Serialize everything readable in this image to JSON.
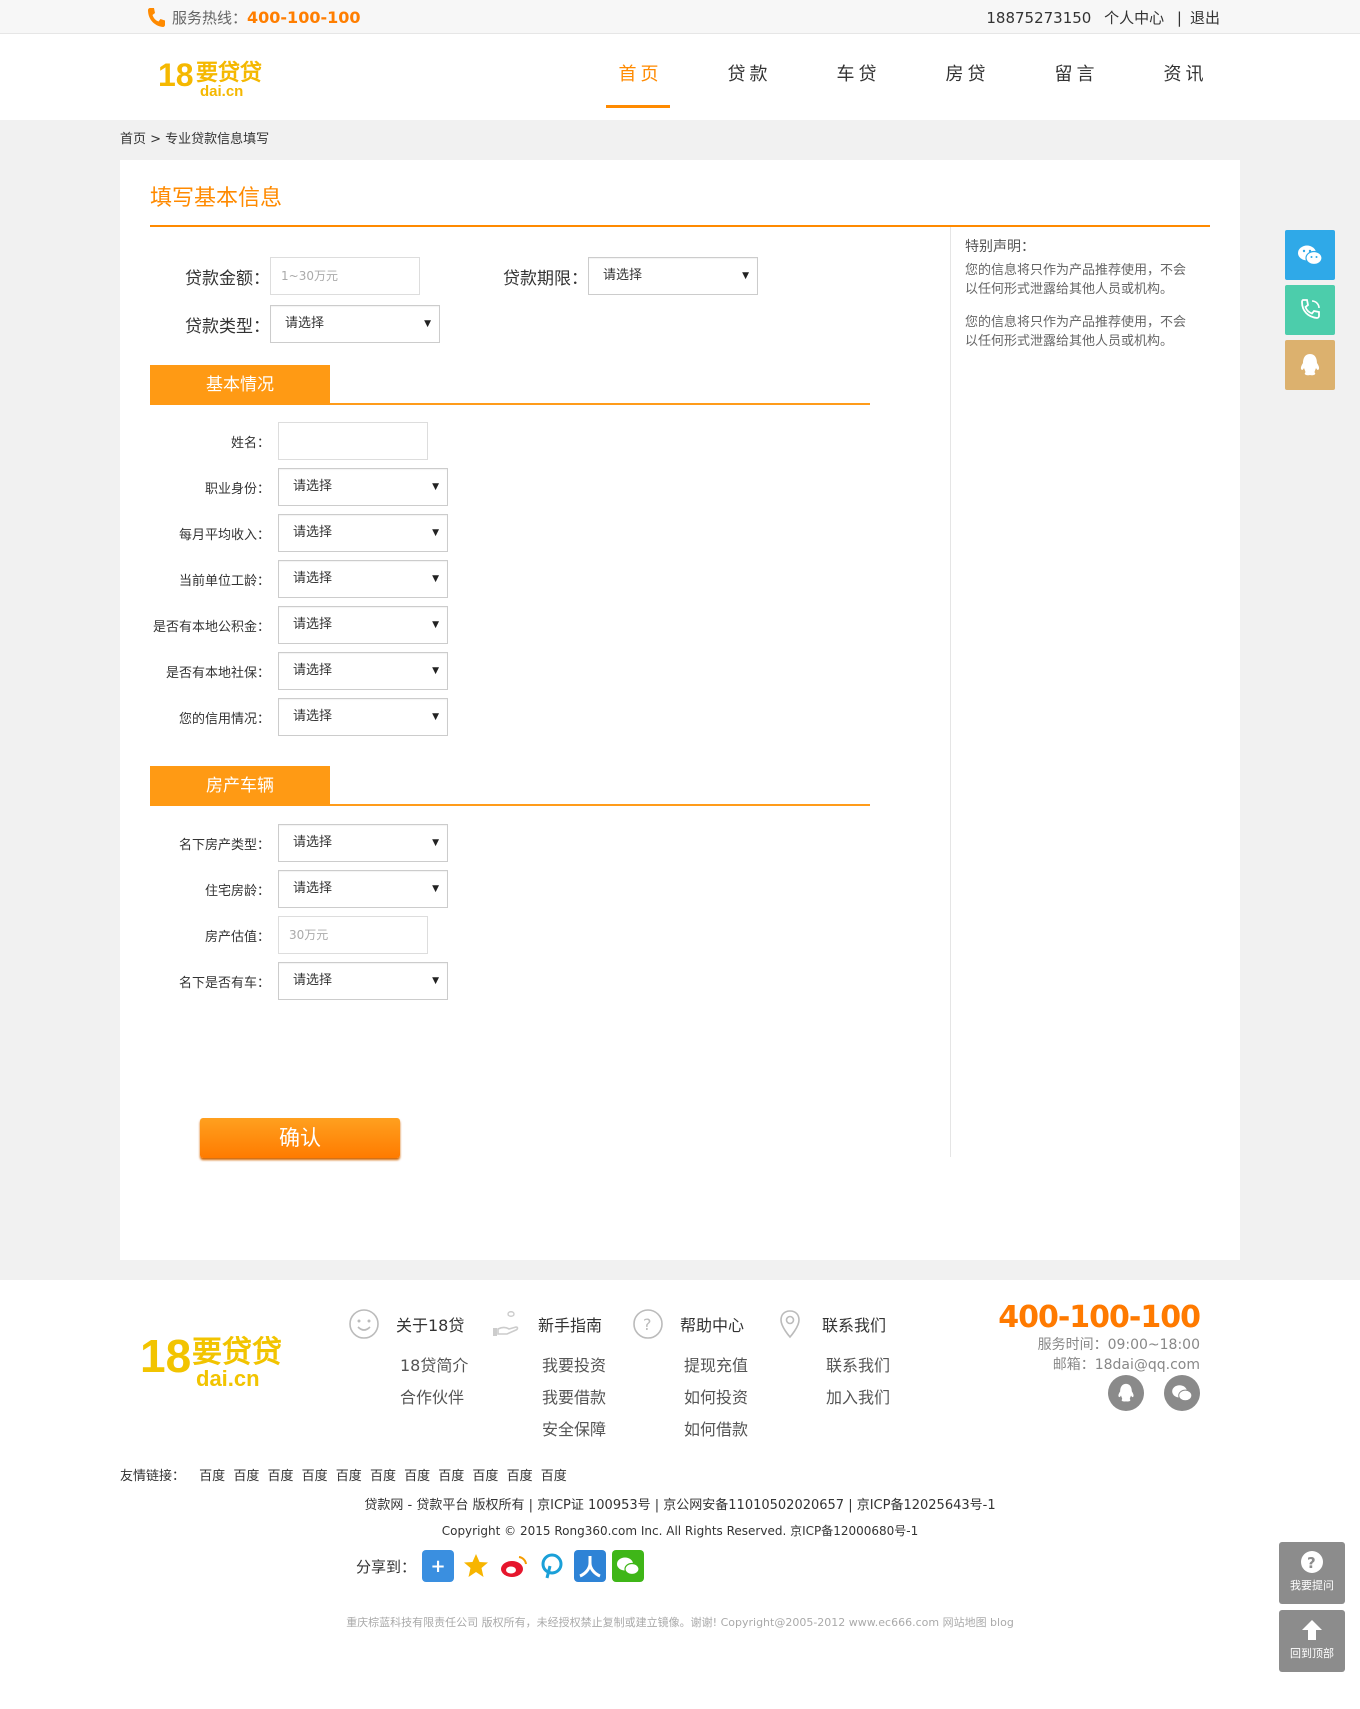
{
  "topbar": {
    "hotline_label": "服务热线：",
    "hotline_number": "400-100-100",
    "phone": "18875273150",
    "user_center": "个人中心",
    "separator": "|",
    "logout": "退出"
  },
  "header": {
    "logo_text": "18要贷贷 dai.cn",
    "nav": [
      {
        "label": "首页",
        "active": true
      },
      {
        "label": "贷款",
        "active": false
      },
      {
        "label": "车贷",
        "active": false
      },
      {
        "label": "房贷",
        "active": false
      },
      {
        "label": "留言",
        "active": false
      },
      {
        "label": "资讯",
        "active": false
      }
    ]
  },
  "breadcrumb": "首页 > 专业贷款信息填写",
  "main": {
    "title": "填写基本信息",
    "loan_amount_label": "贷款金额：",
    "loan_amount_placeholder": "1~30万元",
    "loan_term_label": "贷款期限：",
    "loan_term_value": "请选择",
    "loan_type_label": "贷款类型：",
    "loan_type_value": "请选择",
    "section_basic": "基本情况",
    "basic_fields": [
      {
        "label": "姓名：",
        "kind": "input",
        "value": ""
      },
      {
        "label": "职业身份：",
        "kind": "select",
        "value": "请选择"
      },
      {
        "label": "每月平均收入：",
        "kind": "select",
        "value": "请选择"
      },
      {
        "label": "当前单位工龄：",
        "kind": "select",
        "value": "请选择"
      },
      {
        "label": "是否有本地公积金：",
        "kind": "select",
        "value": "请选择"
      },
      {
        "label": "是否有本地社保：",
        "kind": "select",
        "value": "请选择"
      },
      {
        "label": "您的信用情况：",
        "kind": "select",
        "value": "请选择"
      }
    ],
    "section_property": "房产车辆",
    "property_fields": [
      {
        "label": "名下房产类型：",
        "kind": "select",
        "value": "请选择"
      },
      {
        "label": "住宅房龄：",
        "kind": "select",
        "value": "请选择"
      },
      {
        "label": "房产估值：",
        "kind": "input",
        "value": "30万元"
      },
      {
        "label": "名下是否有车：",
        "kind": "select",
        "value": "请选择"
      }
    ],
    "confirm": "确认",
    "note_title": "特别声明：",
    "note_1": "您的信息将只作为产品推荐使用，不会以任何形式泄露给其他人员或机构。",
    "note_2": "您的信息将只作为产品推荐使用，不会以任何形式泄露给其他人员或机构。"
  },
  "footer": {
    "logo_text": "18要贷贷 dai.cn",
    "cols": [
      {
        "head": "关于18贷",
        "icon": "smile-icon",
        "links": [
          "18贷简介",
          "合作伙伴"
        ]
      },
      {
        "head": "新手指南",
        "icon": "hand-icon",
        "links": [
          "我要投资",
          "我要借款",
          "安全保障"
        ]
      },
      {
        "head": "帮助中心",
        "icon": "question-icon",
        "links": [
          "提现充值",
          "如何投资",
          "如何借款"
        ]
      },
      {
        "head": "联系我们",
        "icon": "location-icon",
        "links": [
          "联系我们",
          "加入我们"
        ]
      }
    ],
    "hotline": "400-100-100",
    "service_time": "服务时间：09:00~18:00",
    "email": "邮箱：18dai@qq.com",
    "friend_label": "友情链接：",
    "friend_links": [
      "百度",
      "百度",
      "百度",
      "百度",
      "百度",
      "百度",
      "百度",
      "百度",
      "百度",
      "百度",
      "百度"
    ],
    "copy1": "贷款网 - 贷款平台 版权所有 | 京ICP证 100953号 | 京公网安备11010502020657 | 京ICP备12025643号-1",
    "copy2": "Copyright © 2015 Rong360.com Inc. All Rights Reserved. 京ICP备12000680号-1",
    "share_label": "分享到：",
    "copy3": "重庆棕蓝科技有限责任公司 版权所有，未经授权禁止复制或建立镜像。谢谢! Copyright@2005-2012 www.ec666.com 网站地图 blog",
    "ask_label": "我要提问",
    "top_label": "回到顶部"
  },
  "colors": {
    "accent": "#ff8a00",
    "wechat": "#2fa9e8",
    "tel": "#4ccdab",
    "qq": "#dcb16e"
  }
}
